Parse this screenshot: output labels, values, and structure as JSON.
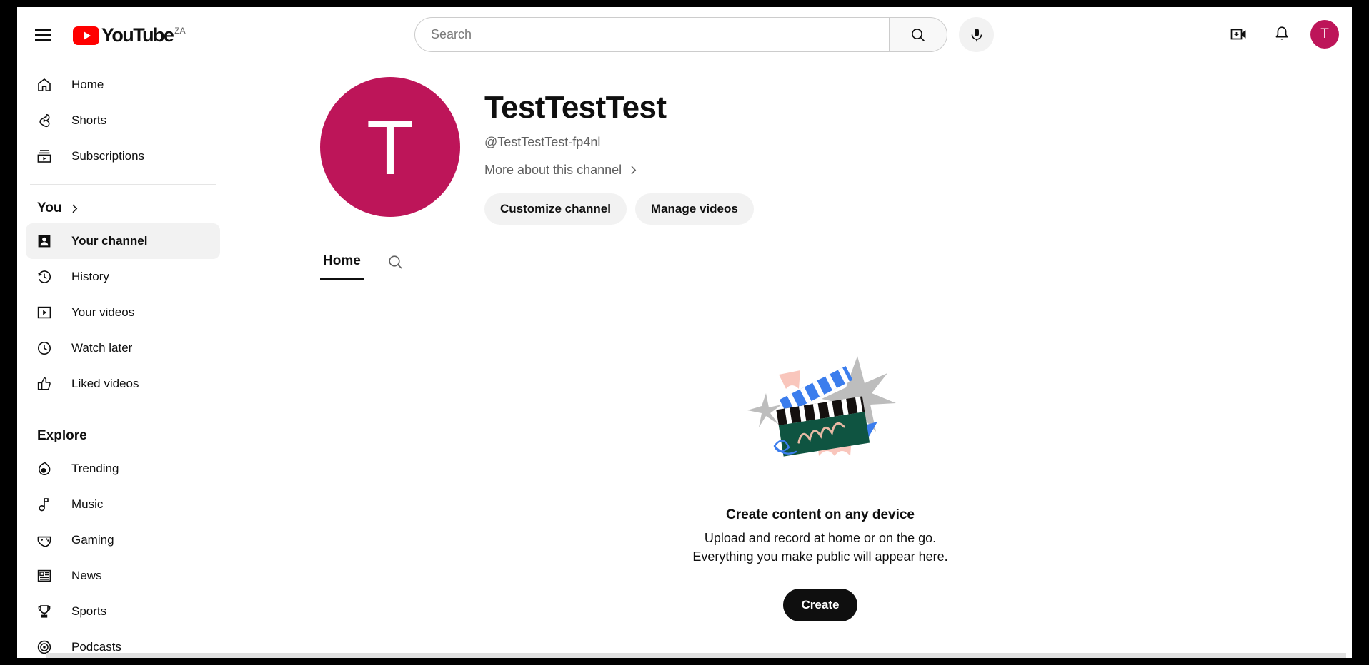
{
  "header": {
    "menu_icon": "hamburger-menu-icon",
    "logo_text": "YouTube",
    "country_code": "ZA",
    "search_placeholder": "Search",
    "search_value": "",
    "search_icon": "search-icon",
    "mic_icon": "microphone-icon",
    "create_video_icon": "create-video-icon",
    "notifications_icon": "bell-icon",
    "avatar_letter": "T"
  },
  "colors": {
    "brand_red": "#ff0000",
    "avatar_pink": "#bd1559",
    "text_primary": "#0f0f0f",
    "text_secondary": "#606060",
    "active_pill": "#f2f2f2"
  },
  "sidebar": {
    "primary": [
      {
        "label": "Home",
        "icon": "home-icon",
        "active": false
      },
      {
        "label": "Shorts",
        "icon": "shorts-icon",
        "active": false
      },
      {
        "label": "Subscriptions",
        "icon": "subscriptions-icon",
        "active": false
      }
    ],
    "you_section": {
      "title": "You",
      "chevron_icon": "chevron-right-icon",
      "items": [
        {
          "label": "Your channel",
          "icon": "person-icon",
          "active": true
        },
        {
          "label": "History",
          "icon": "history-icon",
          "active": false
        },
        {
          "label": "Your videos",
          "icon": "play-box-icon",
          "active": false
        },
        {
          "label": "Watch later",
          "icon": "clock-icon",
          "active": false
        },
        {
          "label": "Liked videos",
          "icon": "thumbs-up-icon",
          "active": false
        }
      ]
    },
    "explore_section": {
      "title": "Explore",
      "items": [
        {
          "label": "Trending",
          "icon": "flame-icon",
          "active": false
        },
        {
          "label": "Music",
          "icon": "music-note-icon",
          "active": false
        },
        {
          "label": "Gaming",
          "icon": "gamepad-icon",
          "active": false
        },
        {
          "label": "News",
          "icon": "newspaper-icon",
          "active": false
        },
        {
          "label": "Sports",
          "icon": "trophy-icon",
          "active": false
        },
        {
          "label": "Podcasts",
          "icon": "podcast-icon",
          "active": false
        }
      ]
    }
  },
  "channel": {
    "avatar_letter": "T",
    "name": "TestTestTest",
    "handle": "@TestTestTest-fp4nl",
    "more_link": "More about this channel",
    "more_chevron_icon": "chevron-right-icon",
    "customize_button": "Customize channel",
    "manage_button": "Manage videos"
  },
  "tabs": [
    {
      "label": "Home",
      "active": true
    }
  ],
  "tab_search_icon": "search-icon",
  "empty_state": {
    "illustration": "clapperboard-illustration",
    "title": "Create content on any device",
    "line1": "Upload and record at home or on the go.",
    "line2": "Everything you make public will appear here.",
    "button": "Create"
  }
}
